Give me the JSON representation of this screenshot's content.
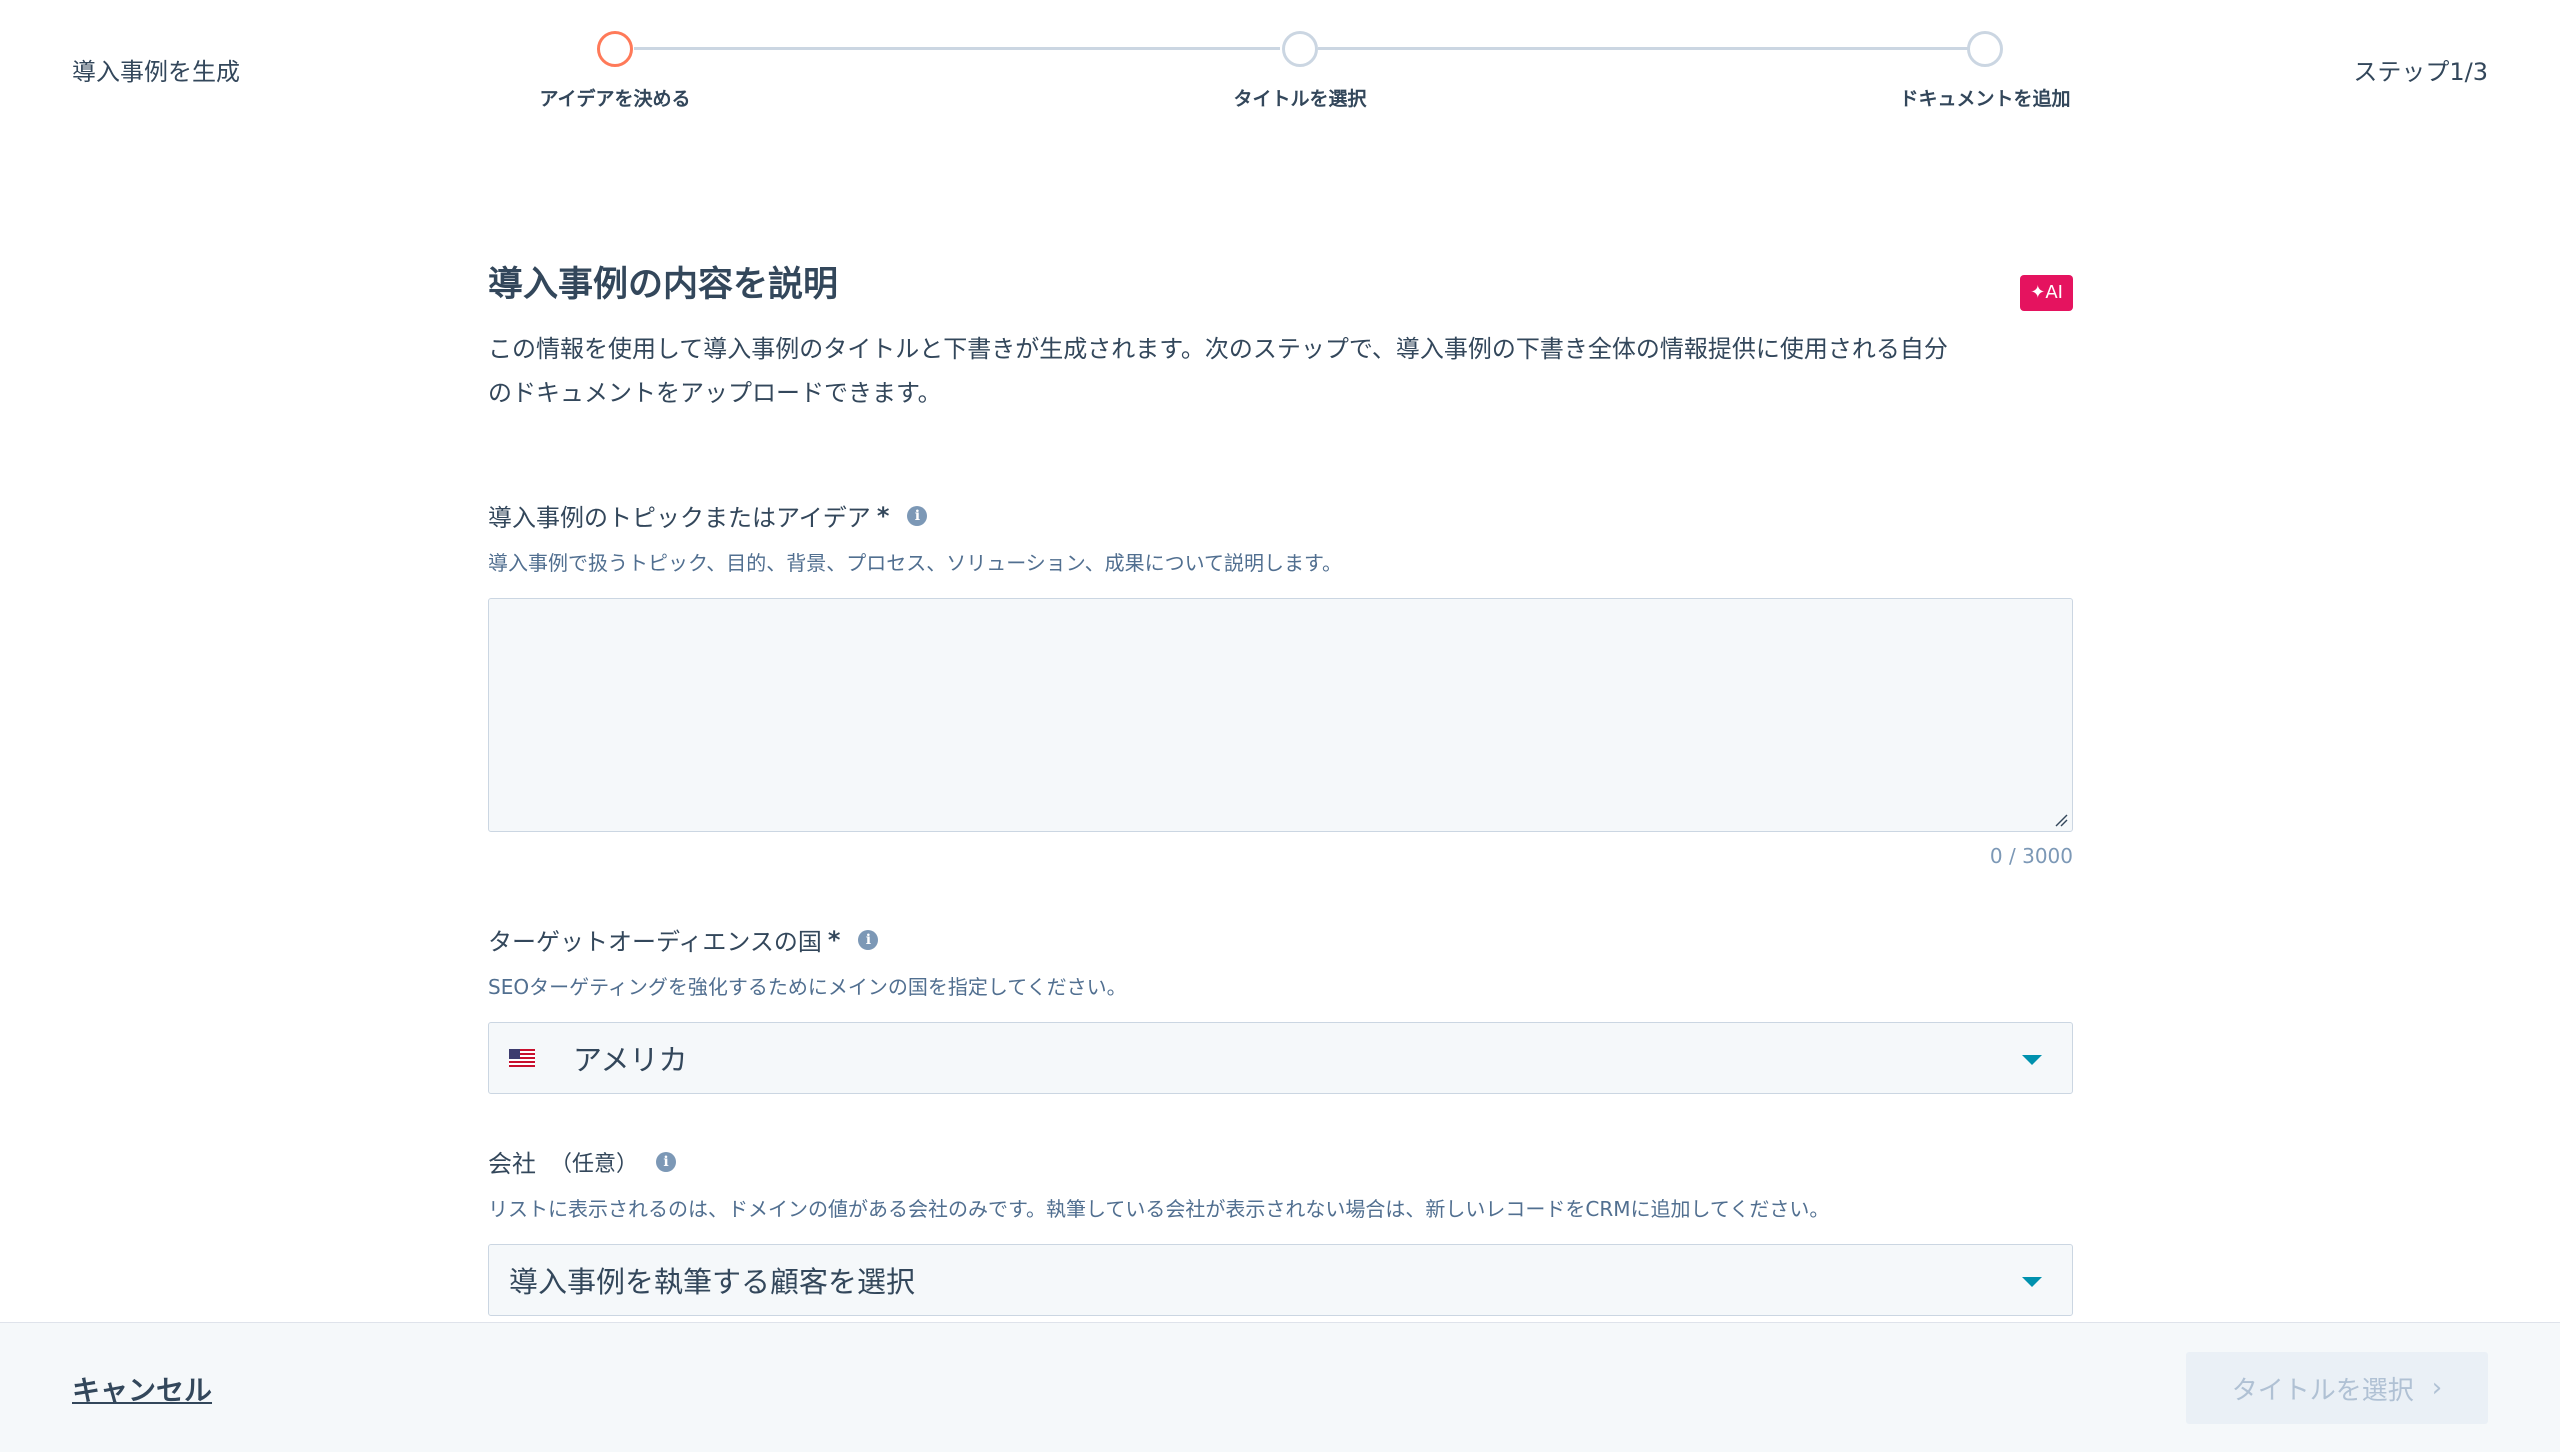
{
  "header": {
    "app_title": "導入事例を生成",
    "step_count": "ステップ1/3",
    "steps": [
      {
        "label": "アイデアを決める",
        "state": "active"
      },
      {
        "label": "タイトルを選択",
        "state": "pending"
      },
      {
        "label": "ドキュメントを追加",
        "state": "pending"
      }
    ]
  },
  "section": {
    "title": "導入事例の内容を説明",
    "ai_badge": "✦AI",
    "description_line1": "この情報を使用して導入事例のタイトルと下書きが生成されます。次のステップで、導入事例の下書き全体の情報提供に使用される自分",
    "description_line2": "のドキュメントをアップロードできます。"
  },
  "topic_field": {
    "label": "導入事例のトピックまたはアイデア",
    "required_mark": "*",
    "info_icon": "i",
    "help": "導入事例で扱うトピック、目的、背景、プロセス、ソリューション、成果について説明します。",
    "value": "",
    "char_count": "0 / 3000"
  },
  "country_field": {
    "label": "ターゲットオーディエンスの国",
    "required_mark": "*",
    "info_icon": "i",
    "help": "SEOターゲティングを強化するためにメインの国を指定してください。",
    "selected": "アメリカ",
    "flag_icon": "us-flag-icon"
  },
  "company_field": {
    "label": "会社",
    "optional": "（任意）",
    "info_icon": "i",
    "help": "リストに表示されるのは、ドメインの値がある会社のみです。執筆している会社が表示されない場合は、新しいレコードをCRMに追加してください。",
    "placeholder": "導入事例を執筆する顧客を選択"
  },
  "footer": {
    "cancel_label": "キャンセル",
    "next_label": "タイトルを選択",
    "next_icon": "›"
  },
  "colors": {
    "accent_active": "#ff7a59",
    "ai_badge": "#e5135f",
    "caret": "#0091ae",
    "text": "#33475b",
    "disabled_text": "#b0c1d4"
  }
}
